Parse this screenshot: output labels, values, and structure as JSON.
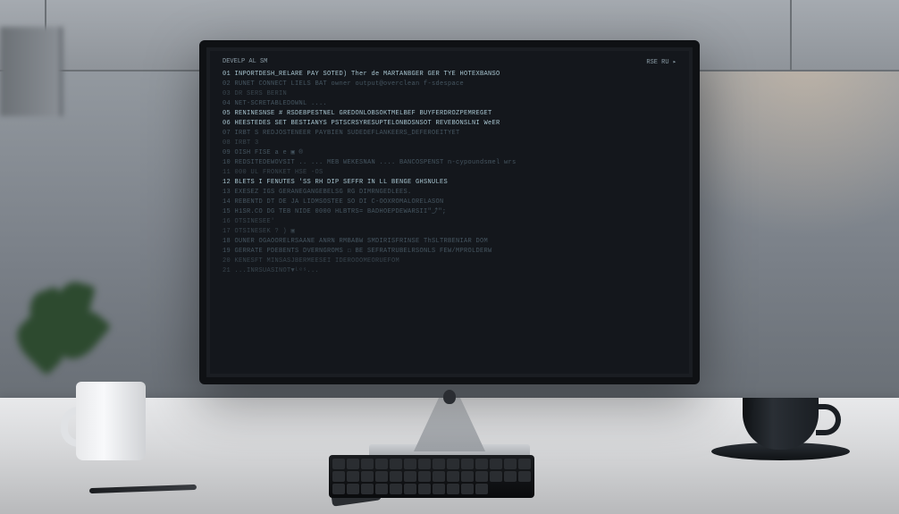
{
  "scene": {
    "description": "Desktop computer displaying code editor in modern room",
    "monitor_type": "iMac-style all-in-one"
  },
  "code_editor": {
    "header_left": "DEVELP  AL SM",
    "header_right": "RSE RU  ▸",
    "lines": [
      "01  INPORTDESH_RELARE PAY SOTED)         Ther de  MARTANBGER GER TYE HOTEXBANSO",
      "02  RUNET CONNECT                        LIELS BAT owner  output@overclean f-sdespace",
      "03  DR  SERS BERIN",
      "04  NET-SCRETABLEDOWNL    ....",
      "05  RENINESNSE # RSDEBPESTNEL GREDONLOBSOKTMELBEF  BUYFERDROZPEMREGET",
      "06  HEESTEDES SET BESTIANYS PSTSCRSYRESUPTELONBDSNSOT REVEBONSLNI WeER",
      "07  IRBT S                REDJOSTENEER  PAYBIEN  SUDEDEFLANKEERS_DEFEROEITYET",
      "08  IRBT 3",
      "09  OISH   FISE a               e                            ▣ ®",
      "10  REDSITEDEWOVSIT ..   ...       MEB WEKESNAN ....    BANCOSPENST  n-cypoundsmel wrs",
      "11  000 UL  FRONKET  HSE -OS",
      "12  BLETS I FENUTES 'SS RH DIP   SEFFR  IN LL    BENGE GHSNULES",
      "13  EXESEZ IGS  GERANEGANGEBELSG RG  DIMRNGEDLEES.",
      "14  REBENTD  DT DE JA LIDMSOSTEE SO  DI C-OOXROMALORELASON",
      "15  H1SR.CO DG TEB NIDE 0000  HLBTRS=  BADHOEPDEWARSII\"⤴\";",
      "16  OTSINESEE'",
      "17  OTSINESEK ?  )                                          ▣",
      "18  OUNER  OGAOORELRSAANE ANRN     RMBABW SMDIRISFRINSE       ThSLTRBENIAR   DOM",
      "19  GERRATE PDEBENTS  DVERNGROMS    ☐ BE  SEFRATRUBELRSONLS  FEW/MPROLDERW",
      "20  KENESFT MINSASJBERMEESEI         IDEROOOMEORUEFOM",
      "21      ...INRSUASINOT▼ᴸᵉˢ..."
    ]
  }
}
